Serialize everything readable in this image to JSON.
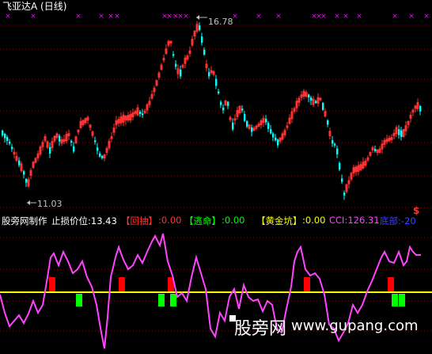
{
  "header": {
    "title": "飞亚达A",
    "period": "(日线)"
  },
  "price_chart": {
    "high_label": "16.78",
    "low_label": "11.03",
    "signal_glyph": "$",
    "colors": {
      "up": "#ff3232",
      "down": "#00ffff",
      "marker": "#ff00ff",
      "grid": "#8b0000",
      "text": "#c0c0c0",
      "signal": "#ff3232"
    }
  },
  "indicator_bar": {
    "name": "股旁网制作",
    "stop_label": "止损价位:13.43",
    "huichou": "【回抽】",
    "huichou_value": ":0.00",
    "taoming": "【逃命】",
    "taoming_value": ":0.00",
    "huangjin": "【黄金坑】",
    "huangjin_value": ":0.00",
    "cci": "CCI:126.31",
    "dibu": "底部:-20"
  },
  "indicator_colors": {
    "name": "#ffffff",
    "stop": "#ffffff",
    "huichou": "#ff3232",
    "taoming": "#00ff00",
    "huangjin": "#ffff00",
    "cci": "#ff44ff",
    "dibu": "#4040ff",
    "line": "#ff44ff",
    "baseline": "#ffff00",
    "red_bar": "#ff0000",
    "green_bar": "#00ff00"
  },
  "watermark": {
    "cn": "股旁网",
    "url": "www.gupang.com"
  }
}
